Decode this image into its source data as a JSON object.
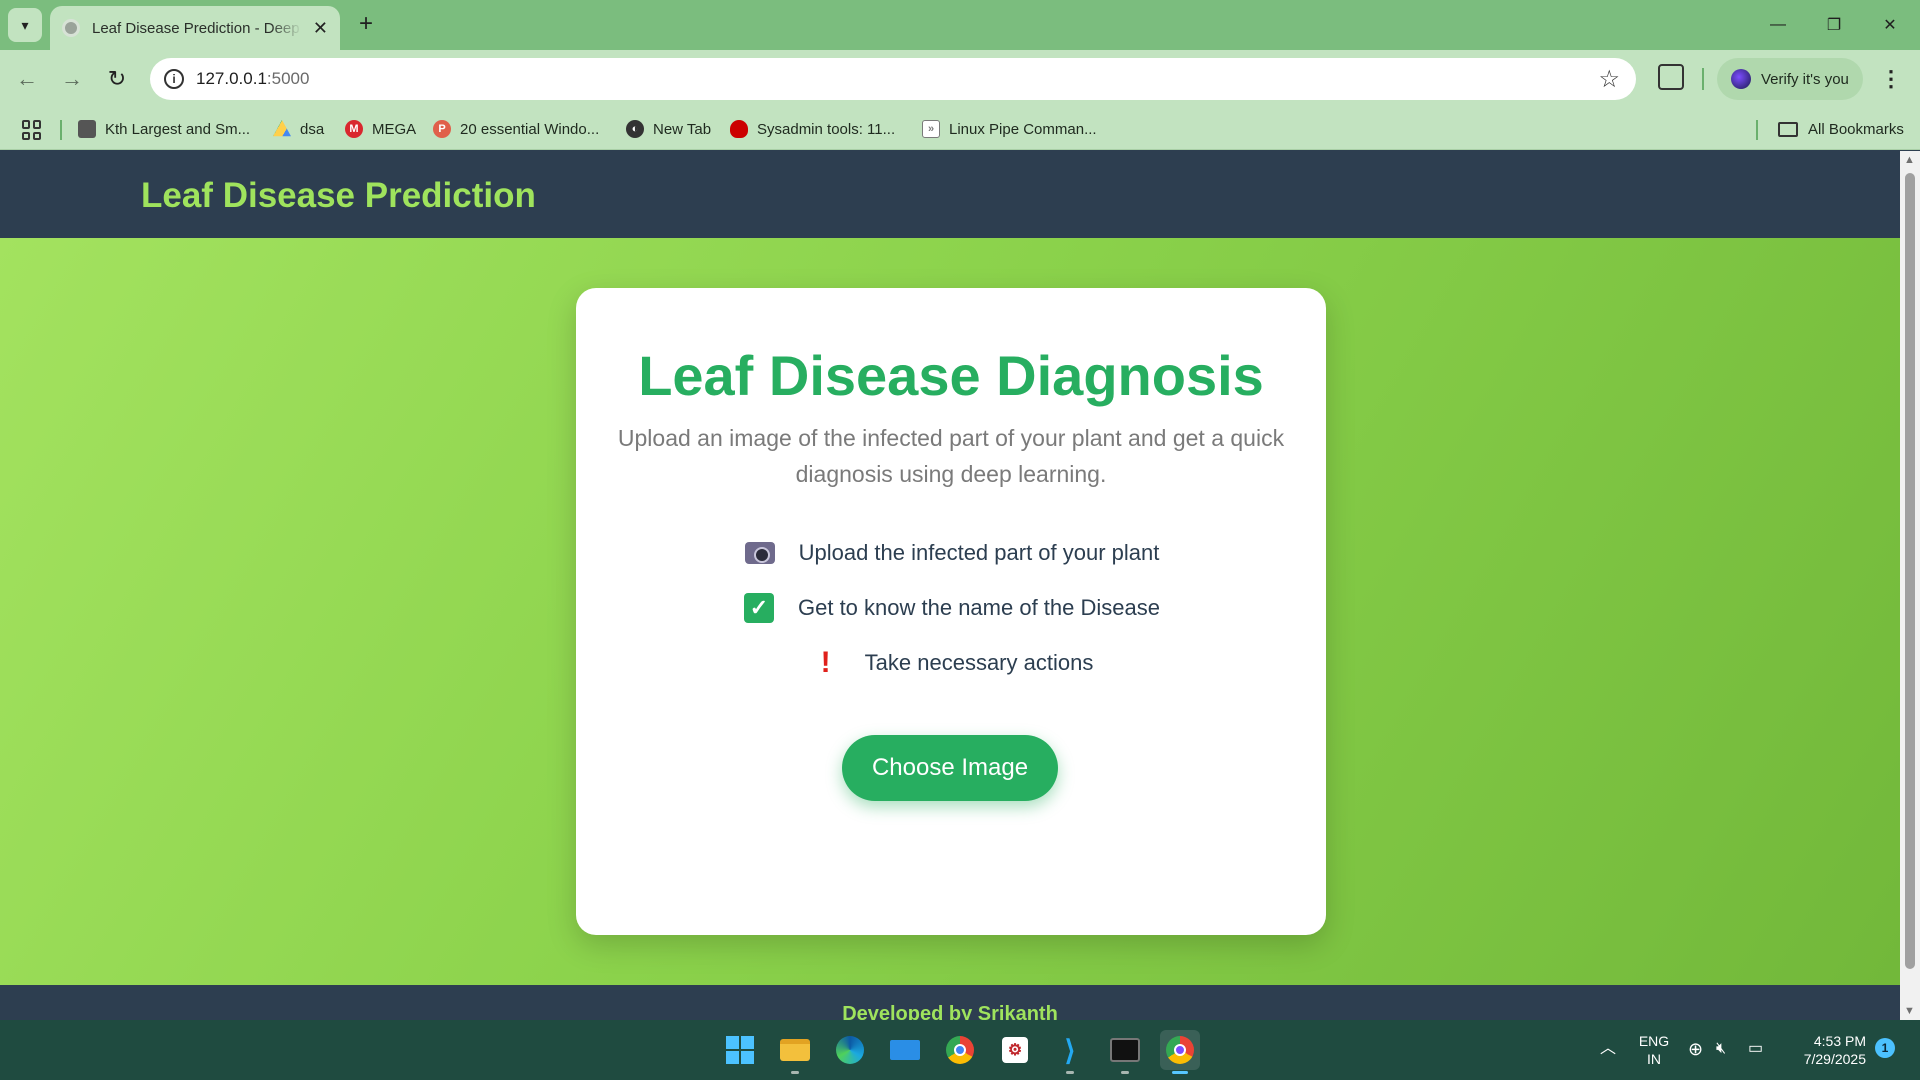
{
  "browser": {
    "tab_title": "Leaf Disease Prediction - Deep L",
    "tab_close": "✕",
    "new_tab": "+",
    "url_host": "127.0.0.1",
    "url_port": ":5000",
    "verify_label": "Verify it's you",
    "bookmarks": [
      {
        "label": "Kth Largest and Sm...",
        "icon": "bookmark-favicon-icon",
        "color": "#555555"
      },
      {
        "label": "dsa",
        "icon": "google-drive-icon",
        "color": "#1fa463"
      },
      {
        "label": "MEGA",
        "icon": "mega-icon",
        "color": "#d9272e"
      },
      {
        "label": "20 essential Windo...",
        "icon": "site-favicon-icon",
        "color": "#e0604a"
      },
      {
        "label": "New Tab",
        "icon": "globe-icon",
        "color": "#333333"
      },
      {
        "label": "Sysadmin tools: 11...",
        "icon": "redhat-icon",
        "color": "#cc0000"
      },
      {
        "label": "Linux Pipe Comman...",
        "icon": "site-favicon-icon",
        "color": "#7a7a7a"
      }
    ],
    "all_bookmarks": "All Bookmarks"
  },
  "site": {
    "header_title": "Leaf Disease Prediction",
    "card_title": "Leaf Disease Diagnosis",
    "subtitle": "Upload an image of the infected part of your plant and get a quick diagnosis using deep learning.",
    "features": [
      {
        "icon": "camera-icon",
        "text": "Upload the infected part of your plant"
      },
      {
        "icon": "check-box-icon",
        "text": "Get to know the name of the Disease"
      },
      {
        "icon": "exclamation-icon",
        "text": "Take necessary actions"
      }
    ],
    "choose_button": "Choose Image",
    "footer": "Developed by Srikanth"
  },
  "taskbar": {
    "lang_top": "ENG",
    "lang_bottom": "IN",
    "time": "4:53 PM",
    "date": "7/29/2025",
    "notifications": "1"
  },
  "colors": {
    "accent_green": "#27ae60",
    "header_bg": "#2d3e50",
    "header_title": "#9fe35d"
  }
}
